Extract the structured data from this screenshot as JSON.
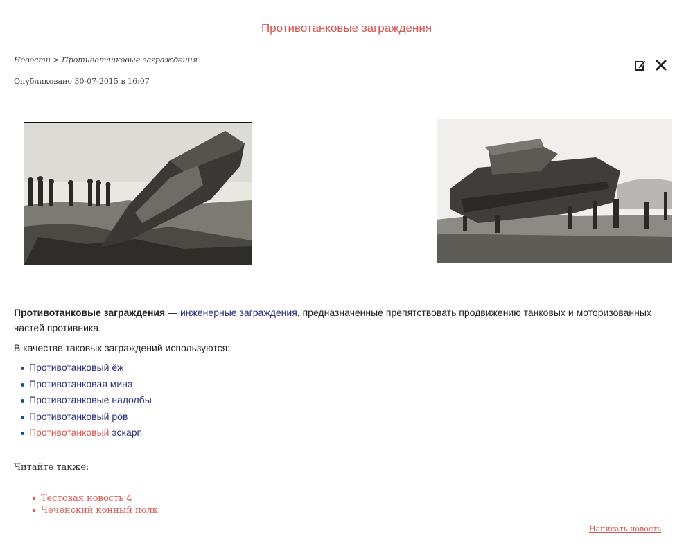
{
  "page": {
    "title": "Противотанковые заграждения"
  },
  "breadcrumb": {
    "home": "Новости",
    "separator": " > ",
    "current": "Противотанковые заграждения"
  },
  "published": "Опубликовано 30-07-2015 в 16:07",
  "toolbar": {
    "edit_icon": "edit-icon",
    "close_icon": "close-icon"
  },
  "images": {
    "left": "black-and-white photo of a WWI tank crossing a trench",
    "right": "black-and-white photo of a tank climbing over anti-tank posts"
  },
  "article": {
    "intro_bold": "Противотанковые заграждения",
    "intro_dash": " — ",
    "intro_link": "инженерные заграждения",
    "intro_rest": ", предназначенные препятствовать продвижению танковых и моторизованных частей противника.",
    "used_as": "В качестве таковых заграждений используются:",
    "items": [
      {
        "label": "Противотанковый ёж"
      },
      {
        "label": "Противотанковая мина"
      },
      {
        "label": "Противотанковые надолбы"
      },
      {
        "label": "Противотанковый ров"
      },
      {
        "label": "Противотанковый",
        "label2": "эскарп"
      }
    ]
  },
  "read_also": {
    "heading": "Читайте также:",
    "links": [
      "Тестовая новость 4",
      "Чеченский конный полк"
    ]
  },
  "write_news": "Написать новость",
  "colors": {
    "accent": "#d9534f",
    "link": "#2a2a7e",
    "bullet": "#17518a"
  }
}
